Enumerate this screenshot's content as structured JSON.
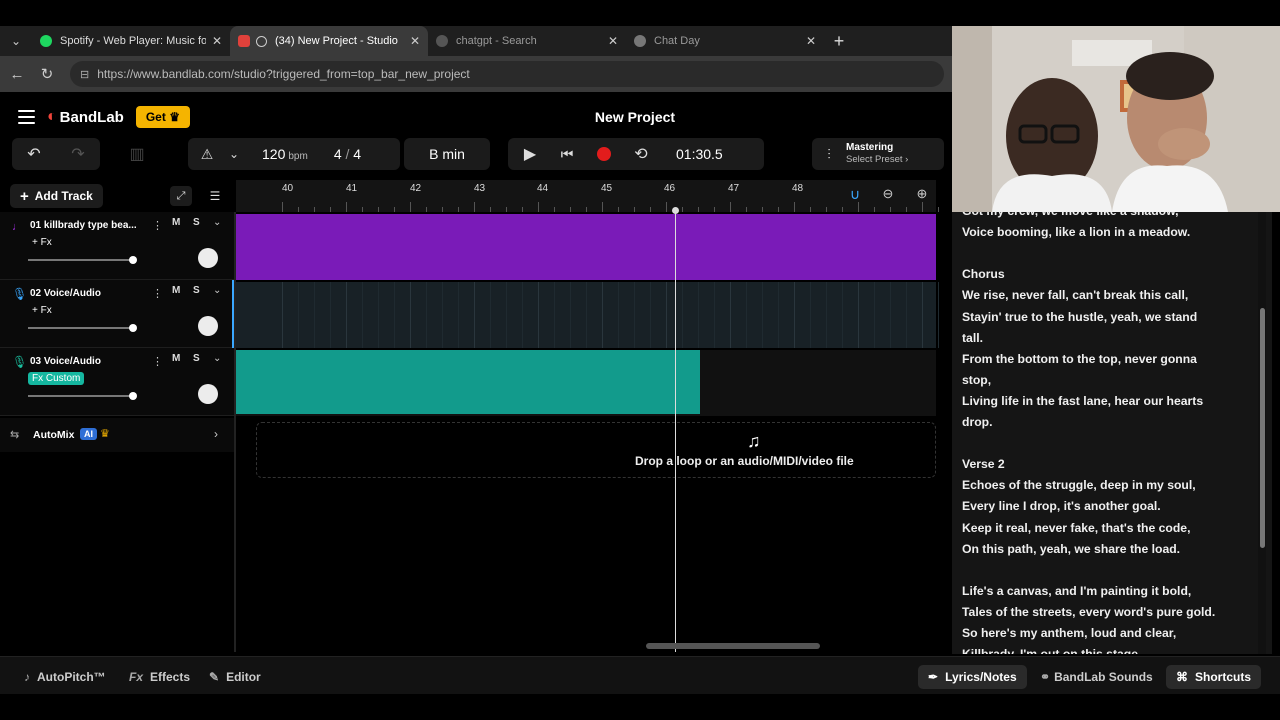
{
  "browser": {
    "tabs": [
      {
        "title": "Spotify - Web Player: Music for ev",
        "favicon_color": "#1ed760"
      },
      {
        "title": "(34) New Project - Studio",
        "favicon_color": "#e0413b"
      },
      {
        "title": "chatgpt - Search",
        "favicon_color": "#555555"
      },
      {
        "title": "Chat Day",
        "favicon_color": "#777777"
      }
    ],
    "url": "https://www.bandlab.com/studio?triggered_from=top_bar_new_project"
  },
  "app": {
    "logo": "BandLab",
    "get_label": "Get",
    "project_title": "New Project",
    "bpm_value": "120",
    "bpm_unit": "bpm",
    "time_sig_num": "4",
    "time_sig_sep": "/",
    "time_sig_den": "4",
    "key": "B min",
    "time": "01:30.5",
    "mastering_title": "Mastering",
    "mastering_sub": "Select Preset",
    "add_track": "Add Track",
    "ruler": [
      "40",
      "41",
      "42",
      "43",
      "44",
      "45",
      "46",
      "47",
      "48"
    ],
    "tracks": [
      {
        "name": "01  killbrady type bea...",
        "fx": "+ Fx",
        "color": "#a22fe0",
        "region_color": "#7a1bb8",
        "mute": "M",
        "solo": "S"
      },
      {
        "name": "02  Voice/Audio",
        "fx": "+ Fx",
        "color": "#3aa8ff",
        "region_color": "",
        "mute": "M",
        "solo": "S"
      },
      {
        "name": "03  Voice/Audio",
        "fx": "Fx Custom",
        "color": "#1bc0a0",
        "region_color": "#129b8c",
        "mute": "M",
        "solo": "S"
      }
    ],
    "automix": "AutoMix",
    "ai_badge": "AI",
    "drop_text": "Drop a loop or an audio/MIDI/video file",
    "bottom": {
      "autopitch": "AutoPitch™",
      "effects": "Effects",
      "effects_prefix": "Fx",
      "editor": "Editor",
      "lyrics_notes": "Lyrics/Notes",
      "bandlab_sounds": "BandLab Sounds",
      "shortcuts": "Shortcuts"
    }
  },
  "lyrics": [
    "Got my crew, we move like a shadow,",
    "Voice booming, like a lion in a meadow.",
    "",
    "Chorus",
    "We rise, never fall, can't break this call,",
    "Stayin' true to the hustle, yeah, we stand",
    "tall.",
    "From the bottom to the top, never gonna",
    "stop,",
    "Living life in the fast lane, hear our hearts",
    "drop.",
    "",
    "Verse 2",
    "Echoes of the struggle, deep in my soul,",
    "Every line I drop, it's another goal.",
    "Keep it real, never fake, that's the code,",
    "On this path, yeah, we share the load.",
    "",
    "Life's a canvas, and I'm painting it bold,",
    "Tales of the streets, every word's pure gold.",
    "So here's my anthem, loud and clear,",
    "Killbrady, I'm out on this stage"
  ]
}
